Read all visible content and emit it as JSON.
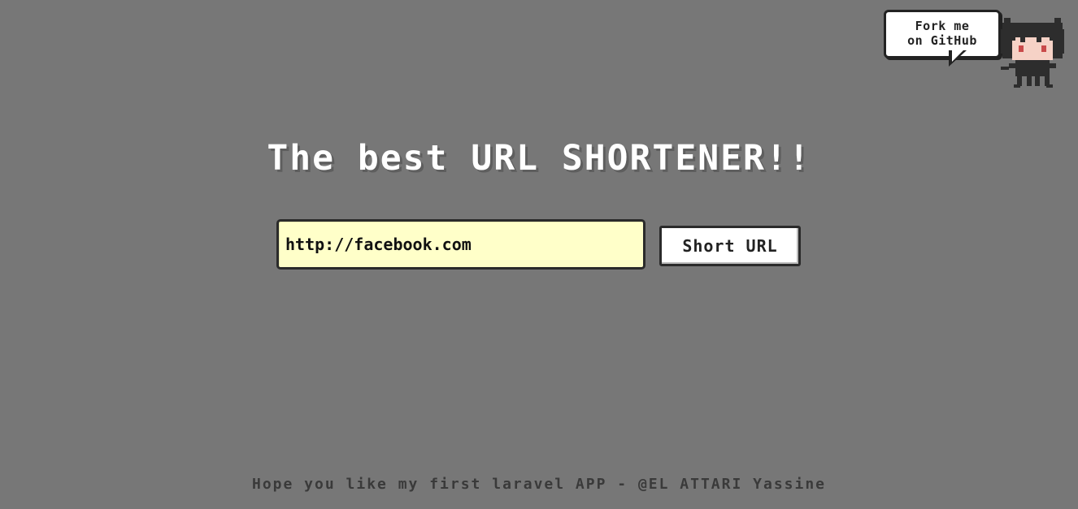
{
  "fork_corner": {
    "line1": "Fork me",
    "line2": "on GitHub",
    "icon": "octocat-icon"
  },
  "headline": "The best URL SHORTENER!!",
  "form": {
    "url_value": "http://facebook.com",
    "submit_label": "Short URL"
  },
  "footer": {
    "credit": "Hope you like my first laravel APP - @EL ATTARI Yassine"
  },
  "colors": {
    "background": "#777777",
    "input_background": "#ffffc9",
    "headline": "#ffffff",
    "footer_text": "#3a3a3a"
  }
}
